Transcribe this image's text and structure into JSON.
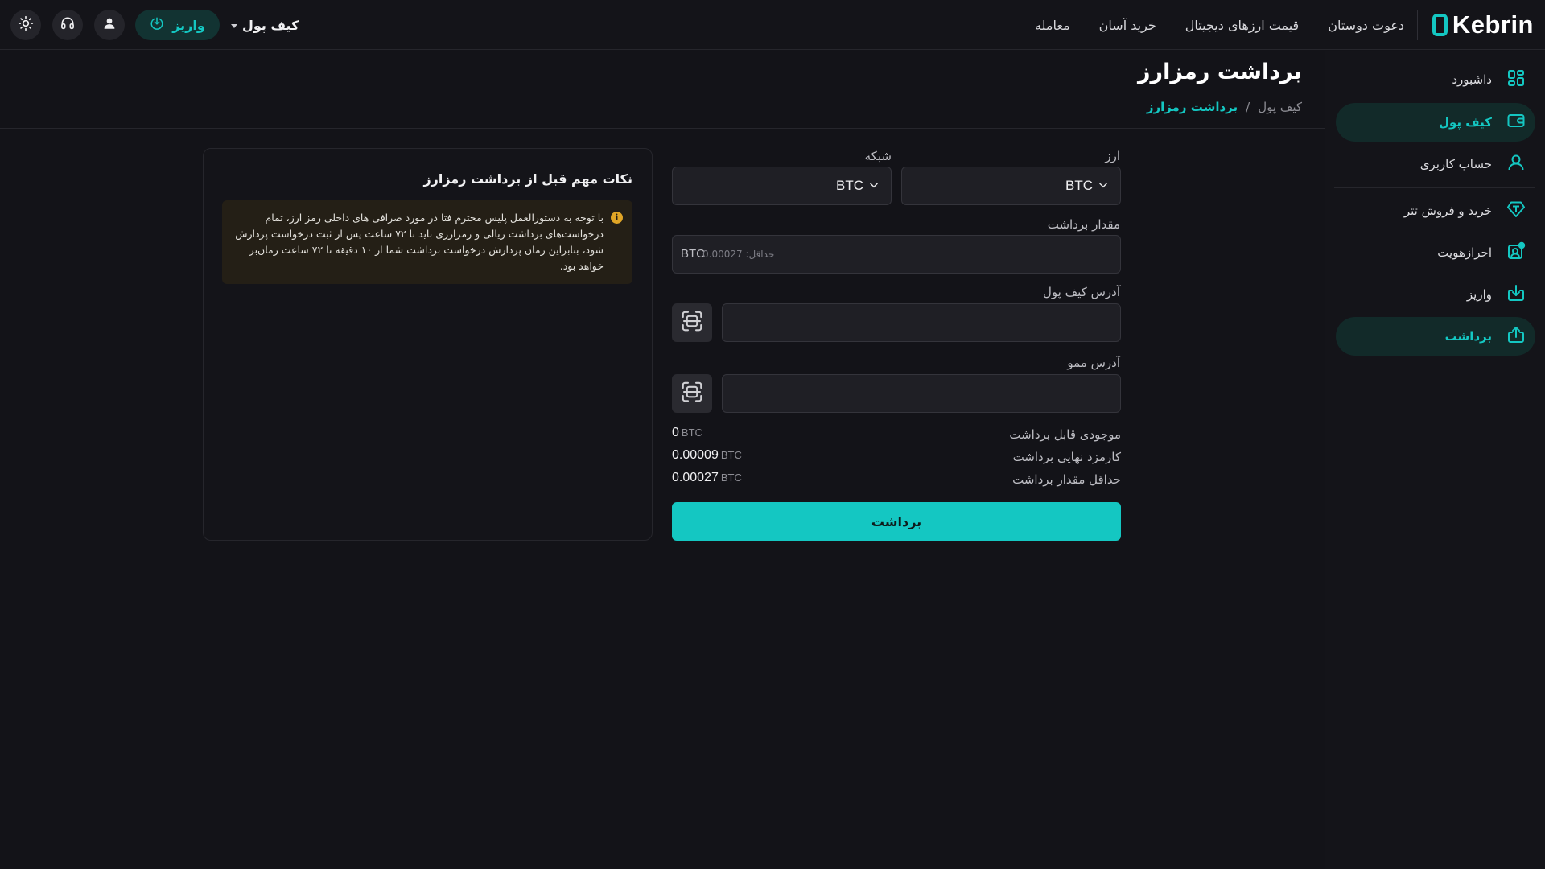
{
  "brand": {
    "name": "Kebrin",
    "accent": "#14c7c2"
  },
  "topnav": {
    "items": [
      "معامله",
      "خرید آسان",
      "قیمت ارزهای دیجیتال",
      "دعوت دوستان"
    ],
    "wallet_menu": "کیف پول",
    "deposit_label": "واریز"
  },
  "sidebar": {
    "items": [
      {
        "label": "داشبورد",
        "icon": "dashboard-icon",
        "active": false
      },
      {
        "label": "کیف پول",
        "icon": "wallet-icon",
        "active": true
      },
      {
        "label": "حساب کاربری",
        "icon": "user-icon",
        "active": false
      },
      {
        "label": "خرید و فروش تتر",
        "icon": "tether-icon",
        "active": false
      },
      {
        "label": "احرازهویت",
        "icon": "verify-icon",
        "active": false
      },
      {
        "label": "واریز",
        "icon": "deposit-icon",
        "active": false
      },
      {
        "label": "برداشت",
        "icon": "withdraw-icon",
        "active": true
      }
    ]
  },
  "page": {
    "title": "برداشت رمزارز",
    "breadcrumb_root": "کیف پول",
    "breadcrumb_sep": "/",
    "breadcrumb_current": "برداشت رمزارز"
  },
  "form": {
    "currency_label": "ارز",
    "currency_value": "BTC",
    "network_label": "شبکه",
    "network_value": "BTC",
    "amount_label": "مقدار برداشت",
    "amount_unit": "BTC",
    "amount_placeholder": "حداقل: 0.00027",
    "wallet_address_label": "آدرس کیف پول",
    "wallet_address_value": "",
    "memo_label": "آدرس ممو",
    "memo_value": "",
    "info": [
      {
        "label": "موجودی قابل برداشت",
        "value": "0",
        "unit": "BTC"
      },
      {
        "label": "کارمزد نهایی برداشت",
        "value": "0.00009",
        "unit": "BTC"
      },
      {
        "label": "حداقل مقدار برداشت",
        "value": "0.00027",
        "unit": "BTC"
      }
    ],
    "submit_label": "برداشت"
  },
  "notes": {
    "title": "نکات مهم قبل از برداشت رمزارز",
    "text": "با توجه به دستورالعمل پلیس محترم فتا در مورد صرافی های داخلی رمز ارز، تمام درخواست‌های برداشت ریالی و رمزارزی باید تا ۷۲ ساعت پس از ثبت درخواست پردازش شود، بنابراین زمان پردازش درخواست برداشت شما از ۱۰ دقیقه تا ۷۲ ساعت زمان‌بر خواهد بود."
  }
}
